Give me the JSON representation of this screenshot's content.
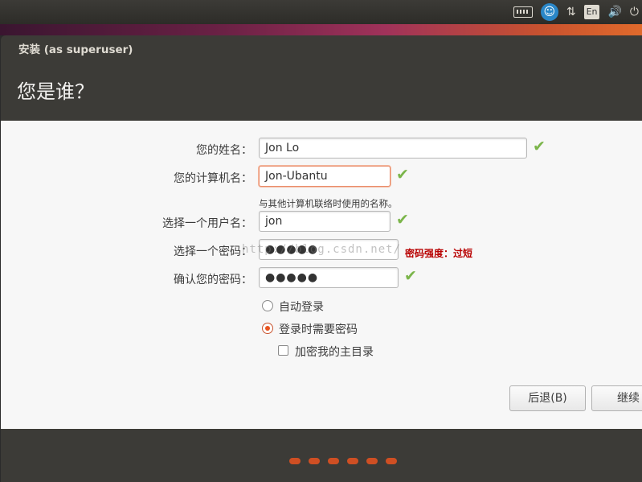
{
  "top_panel": {
    "keyboard_icon": "keyboard-icon",
    "accessibility_icon": "accessibility-icon",
    "network_icon": "network-updown-icon",
    "network_symbol": "⇅",
    "language": "En",
    "volume_symbol": "🔊",
    "power_symbol": "⏻"
  },
  "window": {
    "title": "安装 (as superuser)",
    "page_title": "您是谁？"
  },
  "form": {
    "name_label": "您的姓名：",
    "name_value": "Jon Lo",
    "computer_label": "您的计算机名：",
    "computer_value": "Jon-Ubantu",
    "computer_hint": "与其他计算机联络时使用的名称。",
    "username_label": "选择一个用户名：",
    "username_value": "jon",
    "password_label": "选择一个密码：",
    "password_value": "●●●●●",
    "password_strength": "密码强度：过短",
    "confirm_label": "确认您的密码：",
    "confirm_value": "●●●●●",
    "check_symbol": "✔",
    "watermark": "http://blog.csdn.net/"
  },
  "login": {
    "auto_login": "自动登录",
    "require_password": "登录时需要密码",
    "encrypt_home": "加密我的主目录",
    "selected": "require_password",
    "encrypt_home_checked": false
  },
  "buttons": {
    "back": "后退(B)",
    "continue": "继续"
  },
  "progress": {
    "steps_total": 6
  },
  "colors": {
    "accent": "#e95420",
    "check": "#7bb54a",
    "error": "#b80000"
  }
}
